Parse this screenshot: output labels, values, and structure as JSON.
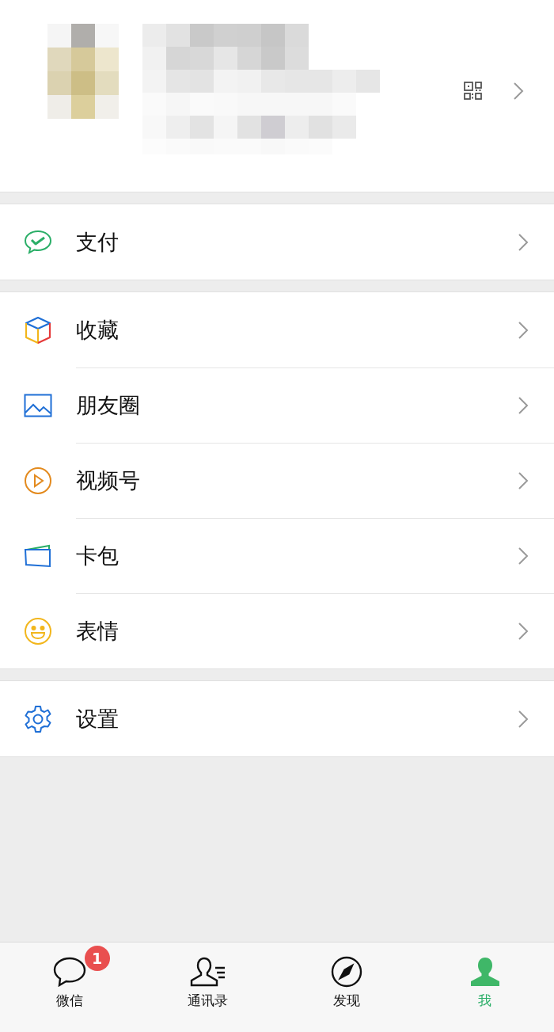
{
  "groups": [
    {
      "items": [
        {
          "kind": "pay",
          "label": "支付"
        }
      ]
    },
    {
      "items": [
        {
          "kind": "favorites",
          "label": "收藏"
        },
        {
          "kind": "moments",
          "label": "朋友圈"
        },
        {
          "kind": "channels",
          "label": "视频号"
        },
        {
          "kind": "cards",
          "label": "卡包"
        },
        {
          "kind": "stickers",
          "label": "表情"
        }
      ]
    },
    {
      "items": [
        {
          "kind": "settings",
          "label": "设置"
        }
      ]
    }
  ],
  "tabs": [
    {
      "kind": "chats",
      "label": "微信",
      "selected": false,
      "badge": "1"
    },
    {
      "kind": "contacts",
      "label": "通讯录",
      "selected": false
    },
    {
      "kind": "discover",
      "label": "发现",
      "selected": false
    },
    {
      "kind": "me",
      "label": "我",
      "selected": true
    }
  ]
}
